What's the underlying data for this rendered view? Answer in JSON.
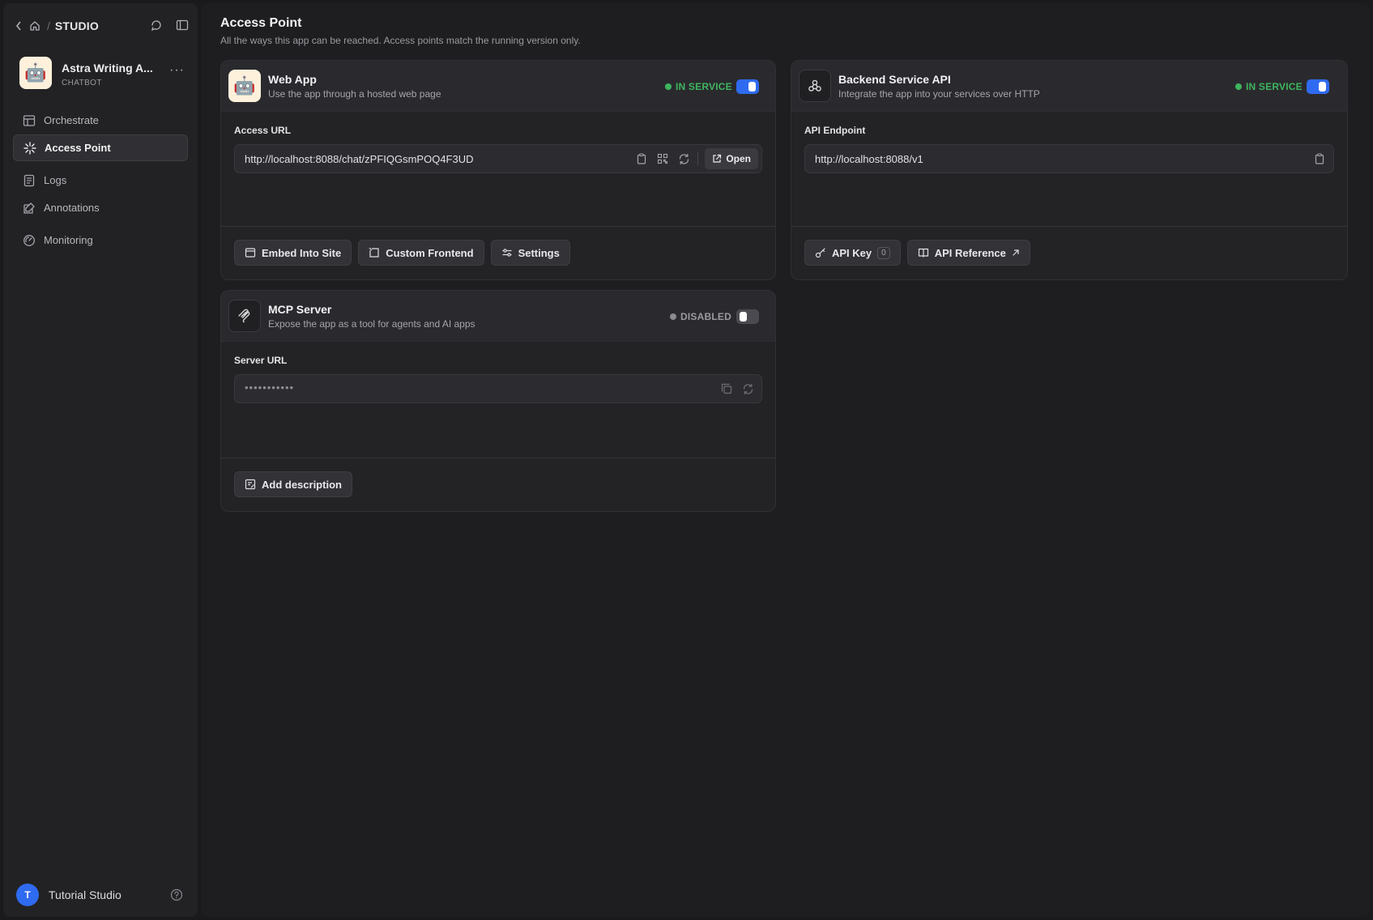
{
  "sidebar": {
    "breadcrumb": {
      "section": "STUDIO"
    },
    "app": {
      "name": "Astra Writing A...",
      "type": "CHATBOT",
      "avatar_emoji": "🤖"
    },
    "nav": [
      {
        "label": "Orchestrate",
        "icon": "layout-icon",
        "active": false
      },
      {
        "label": "Access Point",
        "icon": "sparkle-icon",
        "active": true
      },
      {
        "label": "Logs",
        "icon": "document-icon",
        "active": false
      },
      {
        "label": "Annotations",
        "icon": "annotation-icon",
        "active": false
      },
      {
        "label": "Monitoring",
        "icon": "gauge-icon",
        "active": false
      }
    ],
    "user": {
      "initial": "T",
      "name": "Tutorial Studio"
    }
  },
  "main": {
    "title": "Access Point",
    "subtitle": "All the ways this app can be reached. Access points match the running version only.",
    "web_app": {
      "title": "Web App",
      "description": "Use the app through a hosted web page",
      "status": "IN SERVICE",
      "field_label": "Access URL",
      "url": "http://localhost:8088/chat/zPFIQGsmPOQ4F3UD",
      "open_label": "Open",
      "buttons": {
        "embed": "Embed Into Site",
        "custom": "Custom Frontend",
        "settings": "Settings"
      }
    },
    "backend_api": {
      "title": "Backend Service API",
      "description": "Integrate the app into your services over HTTP",
      "status": "IN SERVICE",
      "field_label": "API Endpoint",
      "url": "http://localhost:8088/v1",
      "buttons": {
        "api_key": "API Key",
        "api_key_count": "0",
        "reference": "API Reference"
      }
    },
    "mcp": {
      "title": "MCP Server",
      "description": "Expose the app as a tool for agents and AI apps",
      "status": "DISABLED",
      "field_label": "Server URL",
      "url": "•••••••••••",
      "buttons": {
        "add_description": "Add description"
      }
    }
  },
  "colors": {
    "accent": "#2f6bf0",
    "in_service": "#3fb55f",
    "disabled": "#8a8a90"
  }
}
